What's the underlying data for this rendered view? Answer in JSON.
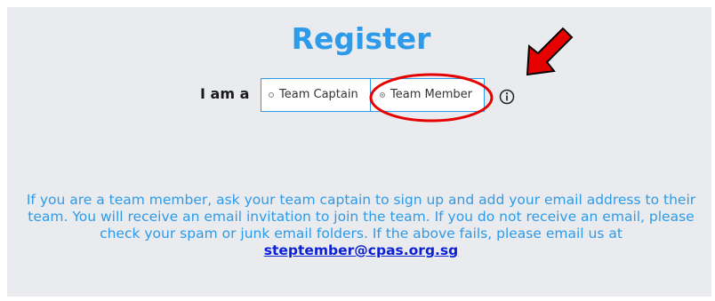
{
  "page": {
    "title": "Register",
    "role_label": "I am a",
    "role_options": [
      {
        "label": "Team Captain",
        "selected": false
      },
      {
        "label": "Team Member",
        "selected": true
      }
    ],
    "help_text": "If you are a team member, ask your team captain to sign up and add your email address to their team. You will receive an email invitation to join the team. If you do not receive an email, please check your spam or junk email folders. If the above fails, please email us at",
    "contact_email": "steptember@cpas.org.sg"
  },
  "icons": {
    "info": "info-icon"
  },
  "colors": {
    "accent": "#2d9be9",
    "link": "#0a1fd6",
    "background": "#e9ebef",
    "annotation": "#e60000"
  }
}
